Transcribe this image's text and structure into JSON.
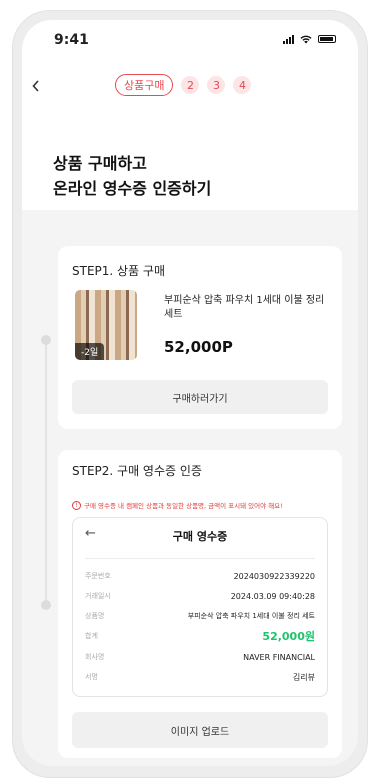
{
  "status_bar": {
    "time": "9:41"
  },
  "stepper": {
    "active_label": "상품구매",
    "steps": [
      "2",
      "3",
      "4"
    ]
  },
  "header": {
    "title_line1": "상품 구매하고",
    "title_line2": "온라인 영수증 인증하기"
  },
  "step1": {
    "title": "STEP1. 상품 구매",
    "product": {
      "badge": "-2일",
      "name": "부피순삭 압축 파우치 1세대 이불 정리 세트",
      "price": "52,000P"
    },
    "button_label": "구매하러가기"
  },
  "step2": {
    "title": "STEP2. 구매 영수증 인증",
    "warning": "구매 영수증 내 캠페인 상품과 동일한 상품명, 금액이 표시돼 있어야 해요!",
    "receipt": {
      "title": "구매 영수증",
      "rows": [
        {
          "label": "주문번호",
          "value": "2024030922339220"
        },
        {
          "label": "거래일시",
          "value": "2024.03.09 09:40:28"
        },
        {
          "label": "상품명",
          "value": "부피순삭 압축 파우치 1세대 이불 정리 세트"
        },
        {
          "label": "합계",
          "value": "52,000원"
        },
        {
          "label": "회사명",
          "value": "NAVER FINANCIAL"
        },
        {
          "label": "서명",
          "value": "김리뷰"
        }
      ]
    },
    "button_label": "이미지 업로드"
  },
  "colors": {
    "accent": "#e84a52",
    "total_green": "#1ec46b"
  }
}
